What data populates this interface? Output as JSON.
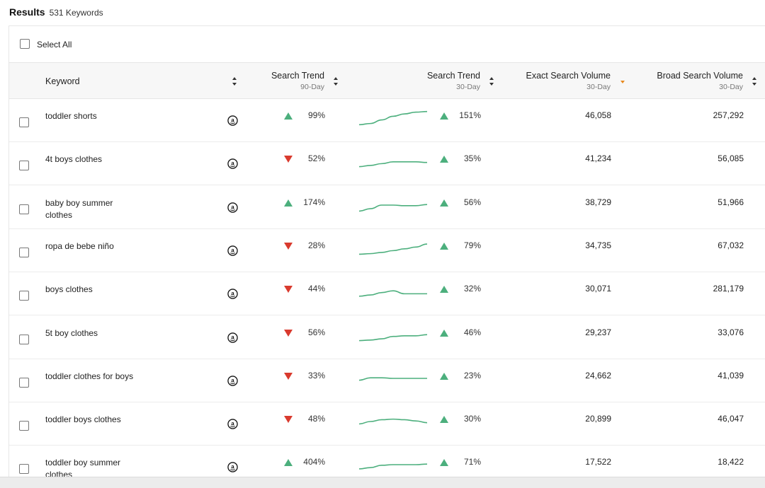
{
  "header": {
    "title": "Results",
    "count": "531 Keywords"
  },
  "select_all_label": "Select All",
  "columns": {
    "keyword": "Keyword",
    "trend90": {
      "label": "Search Trend",
      "sub": "90-Day"
    },
    "trend30": {
      "label": "Search Trend",
      "sub": "30-Day"
    },
    "exact": {
      "label": "Exact Search Volume",
      "sub": "30-Day"
    },
    "broad": {
      "label": "Broad Search Volume",
      "sub": "30-Day"
    }
  },
  "colors": {
    "up": "#4caf7d",
    "down": "#d93a2e",
    "sort_active": "#e8891d",
    "spark": "#4caf7d"
  },
  "icons": {
    "amazon": "amazon-icon",
    "sort": "sort-arrows-icon",
    "up": "trend-up-triangle-icon",
    "down": "trend-down-triangle-icon"
  },
  "rows": [
    {
      "keyword": "toddler shorts",
      "t90_dir": "up",
      "t90": "99%",
      "spark": [
        2,
        4,
        10,
        16,
        20,
        23,
        24
      ],
      "t30_dir": "up",
      "t30": "151%",
      "exact": "46,058",
      "broad": "257,292"
    },
    {
      "keyword": "4t boys clothes",
      "t90_dir": "down",
      "t90": "52%",
      "spark": [
        4,
        6,
        9,
        12,
        12,
        12,
        11
      ],
      "t30_dir": "up",
      "t30": "35%",
      "exact": "41,234",
      "broad": "56,085"
    },
    {
      "keyword": "baby boy summer clothes",
      "t90_dir": "up",
      "t90": "174%",
      "spark": [
        3,
        7,
        13,
        13,
        12,
        12,
        14
      ],
      "t30_dir": "up",
      "t30": "56%",
      "exact": "38,729",
      "broad": "51,966"
    },
    {
      "keyword": "ropa de bebe niño",
      "t90_dir": "down",
      "t90": "28%",
      "spark": [
        3,
        4,
        6,
        9,
        12,
        15,
        20
      ],
      "t30_dir": "up",
      "t30": "79%",
      "exact": "34,735",
      "broad": "67,032"
    },
    {
      "keyword": "boys clothes",
      "t90_dir": "down",
      "t90": "44%",
      "spark": [
        5,
        7,
        11,
        14,
        9,
        9,
        9
      ],
      "t30_dir": "up",
      "t30": "32%",
      "exact": "30,071",
      "broad": "281,179"
    },
    {
      "keyword": "5t boy clothes",
      "t90_dir": "down",
      "t90": "56%",
      "spark": [
        4,
        5,
        7,
        11,
        12,
        12,
        14
      ],
      "t30_dir": "up",
      "t30": "46%",
      "exact": "29,237",
      "broad": "33,076"
    },
    {
      "keyword": "toddler clothes for boys",
      "t90_dir": "down",
      "t90": "33%",
      "spark": [
        10,
        14,
        14,
        13,
        13,
        13,
        13
      ],
      "t30_dir": "up",
      "t30": "23%",
      "exact": "24,662",
      "broad": "41,039"
    },
    {
      "keyword": "toddler boys clothes",
      "t90_dir": "down",
      "t90": "48%",
      "spark": [
        9,
        13,
        16,
        17,
        16,
        14,
        11
      ],
      "t30_dir": "up",
      "t30": "30%",
      "exact": "20,899",
      "broad": "46,047"
    },
    {
      "keyword": "toddler boy summer clothes",
      "t90_dir": "up",
      "t90": "404%",
      "spark": [
        6,
        8,
        12,
        13,
        13,
        13,
        14
      ],
      "t30_dir": "up",
      "t30": "71%",
      "exact": "17,522",
      "broad": "18,422"
    }
  ]
}
